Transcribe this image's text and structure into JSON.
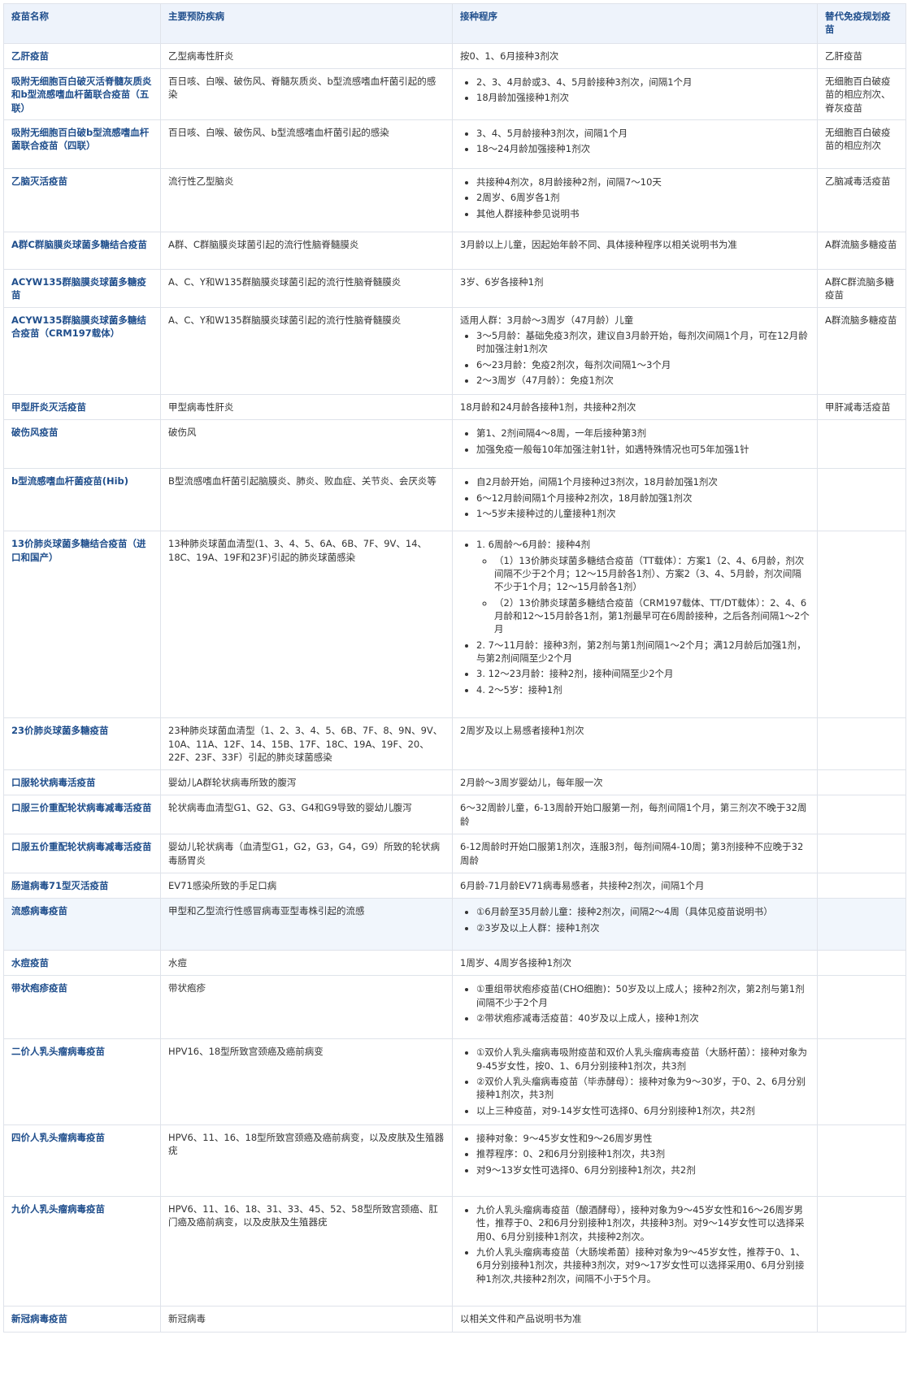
{
  "table": {
    "headers": [
      "疫苗名称",
      "主要预防疾病",
      "接种程序",
      "替代免疫规划疫苗"
    ],
    "rows": [
      {
        "name": "乙肝疫苗",
        "disease": "乙型病毒性肝炎",
        "schedule": "按0、1、6月接种3剂次",
        "alt": "乙肝疫苗"
      },
      {
        "name": "吸附无细胞百白破灭活脊髓灰质炎和b型流感嗜血杆菌联合疫苗（五联）",
        "disease": "百日咳、白喉、破伤风、脊髓灰质炎、b型流感嗜血杆菌引起的感染",
        "items": [
          "2、3、4月龄或3、4、5月龄接种3剂次，间隔1个月",
          "18月龄加强接种1剂次"
        ],
        "alt": "无细胞百白破疫苗的相应剂次、脊灰疫苗"
      },
      {
        "name": "吸附无细胞百白破b型流感嗜血杆菌联合疫苗（四联）",
        "disease": "百日咳、白喉、破伤风、b型流感嗜血杆菌引起的感染",
        "items": [
          "3、4、5月龄接种3剂次，间隔1个月",
          "18～24月龄加强接种1剂次"
        ],
        "alt": "无细胞百白破疫苗的相应剂次"
      },
      {
        "name": "乙脑灭活疫苗",
        "disease": "流行性乙型脑炎",
        "items": [
          "共接种4剂次，8月龄接种2剂，间隔7～10天",
          "2周岁、6周岁各1剂",
          "其他人群接种参见说明书"
        ],
        "alt": "乙脑减毒活疫苗"
      },
      {
        "name": "A群C群脑膜炎球菌多糖结合疫苗",
        "disease": "A群、C群脑膜炎球菌引起的流行性脑脊髓膜炎",
        "schedule": "3月龄以上儿童，因起始年龄不同、具体接种程序以相关说明书为准",
        "alt": "A群流脑多糖疫苗"
      },
      {
        "name": "ACYW135群脑膜炎球菌多糖疫苗",
        "disease": "A、C、Y和W135群脑膜炎球菌引起的流行性脑脊髓膜炎",
        "schedule": "3岁、6岁各接种1剂",
        "alt": "A群C群流脑多糖疫苗"
      },
      {
        "name": "ACYW135群脑膜炎球菌多糖结合疫苗（CRM197载体）",
        "disease": "A、C、Y和W135群脑膜炎球菌引起的流行性脑脊髓膜炎",
        "schedule": "适用人群：3月龄～3周岁（47月龄）儿童",
        "items": [
          "3～5月龄：基础免疫3剂次，建议自3月龄开始，每剂次间隔1个月，可在12月龄时加强注射1剂次",
          "6～23月龄：免疫2剂次，每剂次间隔1～3个月",
          "2～3周岁（47月龄）：免疫1剂次"
        ],
        "alt": "A群流脑多糖疫苗"
      },
      {
        "name": "甲型肝炎灭活疫苗",
        "disease": "甲型病毒性肝炎",
        "schedule": "18月龄和24月龄各接种1剂，共接种2剂次",
        "alt": "甲肝减毒活疫苗"
      },
      {
        "name": "破伤风疫苗",
        "disease": "破伤风",
        "items": [
          "第1、2剂间隔4～8周，一年后接种第3剂",
          "加强免疫一般每10年加强注射1针，如遇特殊情况也可5年加强1针"
        ],
        "alt": ""
      },
      {
        "name": "b型流感嗜血杆菌疫苗(Hib)",
        "disease": "B型流感嗜血杆菌引起脑膜炎、肺炎、败血症、关节炎、会厌炎等",
        "items": [
          "自2月龄开始，间隔1个月接种过3剂次，18月龄加强1剂次",
          "6～12月龄间隔1个月接种2剂次，18月龄加强1剂次",
          "1～5岁未接种过的儿童接种1剂次"
        ],
        "alt": ""
      },
      {
        "name": "13价肺炎球菌多糖结合疫苗（进口和国产）",
        "disease": "13种肺炎球菌血清型(1、3、4、5、6A、6B、7F、9V、14、18C、19A、19F和23F)引起的肺炎球菌感染",
        "items": [
          "1. 6周龄～6月龄：接种4剂",
          "2. 7～11月龄：接种3剂，第2剂与第1剂间隔1～2个月；满12月龄后加强1剂，与第2剂间隔至少2个月",
          "3. 12～23月龄：接种2剂，接种间隔至少2个月",
          "4. 2～5岁：接种1剂"
        ],
        "subitems": [
          "（1）13价肺炎球菌多糖结合疫苗（TT载体）：方案1（2、4、6月龄，剂次间隔不少于2个月；12～15月龄各1剂）、方案2（3、4、5月龄，剂次间隔不少于1个月；12～15月龄各1剂）",
          "（2）13价肺炎球菌多糖结合疫苗（CRM197载体、TT/DT载体）：2、4、6月龄和12～15月龄各1剂，第1剂最早可在6周龄接种，之后各剂间隔1～2个月"
        ],
        "alt": ""
      },
      {
        "name": "23价肺炎球菌多糖疫苗",
        "disease": "23种肺炎球菌血清型（1、2、3、4、5、6B、7F、8、9N、9V、10A、11A、12F、14、15B、17F、18C、19A、19F、20、22F、23F、33F）引起的肺炎球菌感染",
        "schedule": "2周岁及以上易感者接种1剂次",
        "alt": ""
      },
      {
        "name": "口服轮状病毒活疫苗",
        "disease": "婴幼儿A群轮状病毒所致的腹泻",
        "schedule": "2月龄～3周岁婴幼儿，每年服一次",
        "alt": ""
      },
      {
        "name": "口服三价重配轮状病毒减毒活疫苗",
        "disease": "轮状病毒血清型G1、G2、G3、G4和G9导致的婴幼儿腹泻",
        "schedule": "6～32周龄儿童，6-13周龄开始口服第一剂，每剂间隔1个月，第三剂次不晚于32周龄",
        "alt": ""
      },
      {
        "name": "口服五价重配轮状病毒减毒活疫苗",
        "disease": "婴幼儿轮状病毒（血清型G1，G2，G3，G4，G9）所致的轮状病毒肠胃炎",
        "schedule": "6-12周龄时开始口服第1剂次，连服3剂，每剂间隔4-10周；第3剂接种不应晚于32周龄",
        "alt": ""
      },
      {
        "name": "肠道病毒71型灭活疫苗",
        "disease": "EV71感染所致的手足口病",
        "schedule": "6月龄-71月龄EV71病毒易感者，共接种2剂次，间隔1个月",
        "alt": ""
      },
      {
        "name": "流感病毒疫苗",
        "disease": "甲型和乙型流行性感冒病毒亚型毒株引起的流感",
        "items": [
          "①6月龄至35月龄儿童：接种2剂次，间隔2～4周（具体见疫苗说明书）",
          "②3岁及以上人群：接种1剂次"
        ],
        "alt": ""
      },
      {
        "name": "水痘疫苗",
        "disease": "水痘",
        "schedule": "1周岁、4周岁各接种1剂次",
        "alt": ""
      },
      {
        "name": "带状疱疹疫苗",
        "disease": "带状疱疹",
        "items": [
          "①重组带状疱疹疫苗(CHO细胞)：50岁及以上成人；接种2剂次，第2剂与第1剂间隔不少于2个月",
          "②带状疱疹减毒活疫苗：40岁及以上成人，接种1剂次"
        ],
        "alt": ""
      },
      {
        "name": "二价人乳头瘤病毒疫苗",
        "disease": "HPV16、18型所致宫颈癌及癌前病变",
        "items": [
          "①双价人乳头瘤病毒吸附疫苗和双价人乳头瘤病毒疫苗（大肠杆菌）：接种对象为9-45岁女性，按0、1、6月分别接种1剂次，共3剂",
          "②双价人乳头瘤病毒疫苗（毕赤酵母）：接种对象为9～30岁，于0、2、6月分别接种1剂次，共3剂",
          "以上三种疫苗，对9-14岁女性可选择0、6月分别接种1剂次，共2剂"
        ],
        "alt": ""
      },
      {
        "name": "四价人乳头瘤病毒疫苗",
        "disease": "HPV6、11、16、18型所致宫颈癌及癌前病变，以及皮肤及生殖器疣",
        "items": [
          "接种对象：9～45岁女性和9～26周岁男性",
          "推荐程序：0、2和6月分别接种1剂次，共3剂",
          "对9～13岁女性可选择0、6月分别接种1剂次，共2剂"
        ],
        "alt": ""
      },
      {
        "name": "九价人乳头瘤病毒疫苗",
        "disease": "HPV6、11、16、18、31、33、45、52、58型所致宫颈癌、肛门癌及癌前病变，以及皮肤及生殖器疣",
        "items": [
          "九价人乳头瘤病毒疫苗（酿酒酵母），接种对象为9～45岁女性和16～26周岁男性，推荐于0、2和6月分别接种1剂次，共接种3剂。对9～14岁女性可以选择采用0、6月分别接种1剂次，共接种2剂次。",
          "九价人乳头瘤病毒疫苗（大肠埃希菌）接种对象为9～45岁女性，推荐于0、1、6月分别接种1剂次，共接种3剂次，对9～17岁女性可以选择采用0、6月分别接种1剂次,共接种2剂次，间隔不小于5个月。"
        ],
        "alt": ""
      },
      {
        "name": "新冠病毒疫苗",
        "disease": "新冠病毒",
        "schedule": "以相关文件和产品说明书为准",
        "alt": ""
      }
    ]
  }
}
